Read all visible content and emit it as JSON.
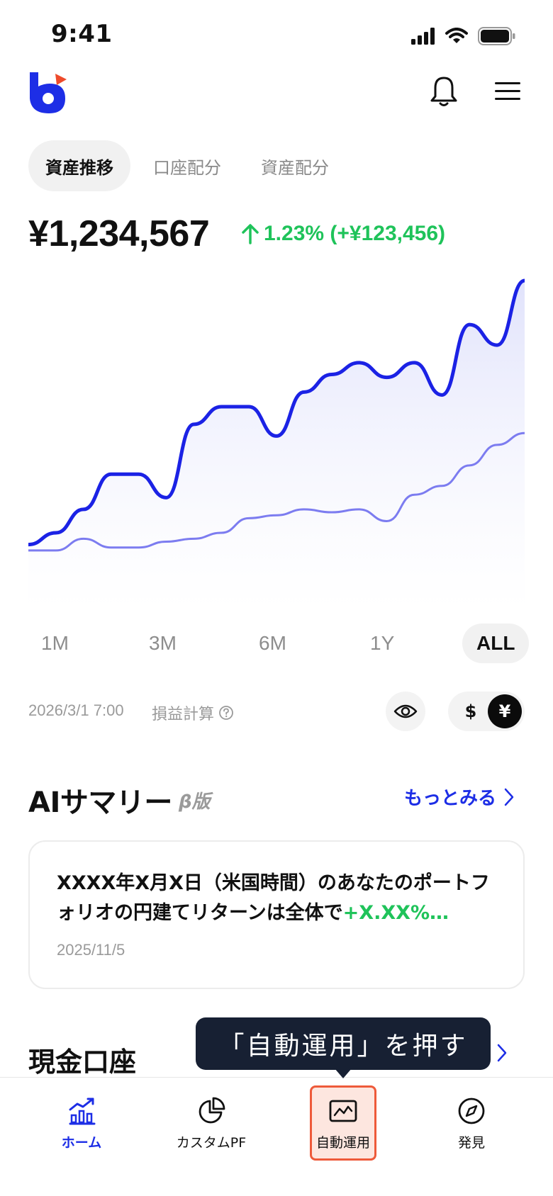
{
  "status_bar": {
    "time": "9:41"
  },
  "tabs": [
    {
      "label": "資産推移",
      "active": true
    },
    {
      "label": "口座配分",
      "active": false
    },
    {
      "label": "資産配分",
      "active": false
    }
  ],
  "balance": {
    "amount": "¥1,234,567",
    "change": "1.23% (+¥123,456)"
  },
  "chart_data": {
    "type": "area",
    "series": [
      {
        "values": [
          10,
          14,
          22,
          34,
          34,
          26,
          51,
          57,
          57,
          47,
          62,
          68,
          72,
          67,
          72,
          61,
          85,
          78,
          100
        ]
      },
      {
        "values": [
          8,
          8,
          12,
          9,
          9,
          11,
          12,
          14,
          19,
          20,
          22,
          21,
          22,
          18,
          27,
          30,
          37,
          44,
          48
        ]
      }
    ],
    "colors": {
      "primary": "#1b22e5",
      "secondary": "#7c7cf0",
      "fill": "#e9eafc"
    }
  },
  "ranges": [
    {
      "label": "1M",
      "active": false
    },
    {
      "label": "3M",
      "active": false
    },
    {
      "label": "6M",
      "active": false
    },
    {
      "label": "1Y",
      "active": false
    },
    {
      "label": "ALL",
      "active": true
    }
  ],
  "meta": {
    "timestamp": "2026/3/1 7:00",
    "pl_label": "損益計算",
    "currency_usd": "$",
    "currency_jpy": "¥"
  },
  "ai_summary": {
    "title": "AIサマリー",
    "beta": "β版",
    "more": "もっとみる",
    "card_text_main": "XXXX年X月X日（米国時間）のあなたのポートフォリオの円建てリターンは全体で",
    "card_text_highlight": "+X.XX%…",
    "card_date": "2025/11/5"
  },
  "cash": {
    "title": "現金口座"
  },
  "tooltip": {
    "text": "「自動運用」を押す"
  },
  "nav": [
    {
      "label": "ホーム",
      "icon": "home-chart-icon",
      "active": true
    },
    {
      "label": "カスタムPF",
      "icon": "pie-chart-icon",
      "active": false
    },
    {
      "label": "自動運用",
      "icon": "auto-invest-icon",
      "active": false,
      "highlighted": true
    },
    {
      "label": "発見",
      "icon": "compass-icon",
      "active": false
    }
  ],
  "colors": {
    "accent": "#1d2ee6",
    "gain": "#1fc35a",
    "tooltip_bg": "#172033",
    "highlight_border": "#ee5a3a"
  }
}
